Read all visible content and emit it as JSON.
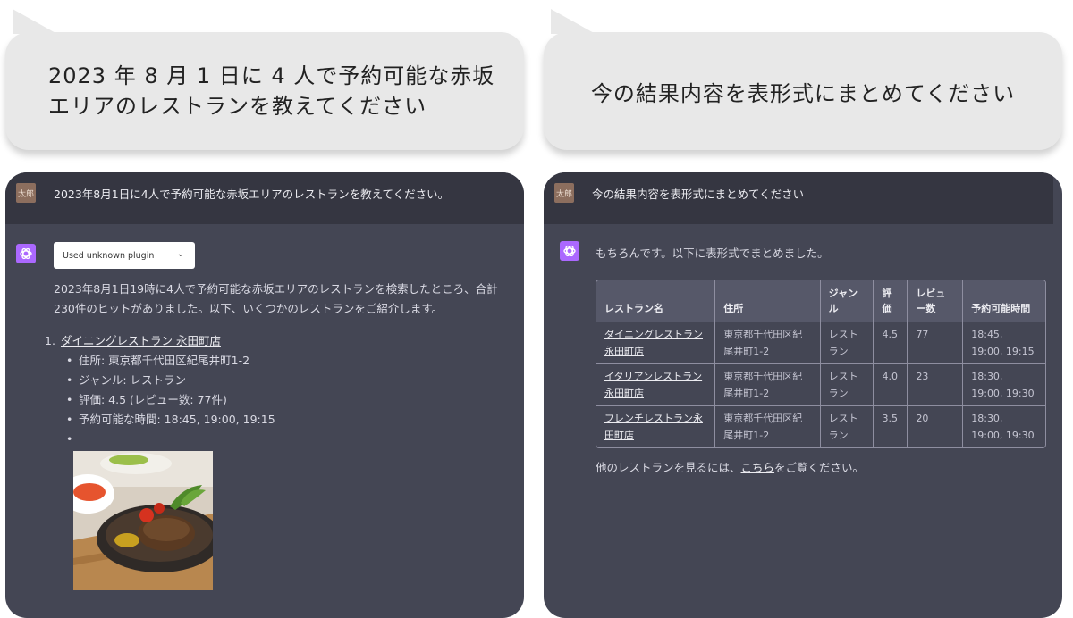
{
  "bubbles": {
    "left": "2023 年 8 月 1 日に 4 人で予約可能な赤坂エリアのレストランを教えてください",
    "right": "今の結果内容を表形式にまとめてください"
  },
  "left_panel": {
    "user_avatar": "太郎",
    "user_message": "2023年8月1日に4人で予約可能な赤坂エリアのレストランを教えてください。",
    "plugin_label": "Used unknown plugin",
    "intro": "2023年8月1日19時に4人で予約可能な赤坂エリアのレストランを検索したところ、合計230件のヒットがありました。以下、いくつかのレストランをご紹介します。",
    "item_number": "1.",
    "item_title": "ダイニングレストラン 永田町店",
    "details": [
      "住所: 東京都千代田区紀尾井町1-2",
      "ジャンル: レストラン",
      "評価: 4.5 (レビュー数: 77件)",
      "予約可能な時間: 18:45, 19:00, 19:15",
      ""
    ]
  },
  "right_panel": {
    "user_avatar": "太郎",
    "user_message": "今の結果内容を表形式にまとめてください",
    "reply": "もちろんです。以下に表形式でまとめました。",
    "table": {
      "headers": [
        "レストラン名",
        "住所",
        "ジャンル",
        "評価",
        "レビュー数",
        "予約可能時間"
      ],
      "rows": [
        [
          "ダイニングレストラン永田町店",
          "東京都千代田区紀尾井町1-2",
          "レストラン",
          "4.5",
          "77",
          "18:45, 19:00, 19:15"
        ],
        [
          "イタリアンレストラン永田町店",
          "東京都千代田区紀尾井町1-2",
          "レストラン",
          "4.0",
          "23",
          "18:30, 19:00, 19:30"
        ],
        [
          "フレンチレストラン永田町店",
          "東京都千代田区紀尾井町1-2",
          "レストラン",
          "3.5",
          "20",
          "18:30, 19:00, 19:30"
        ]
      ]
    },
    "footer_before": "他のレストランを見るには、",
    "footer_link": "こちら",
    "footer_after": "をご覧ください。"
  }
}
